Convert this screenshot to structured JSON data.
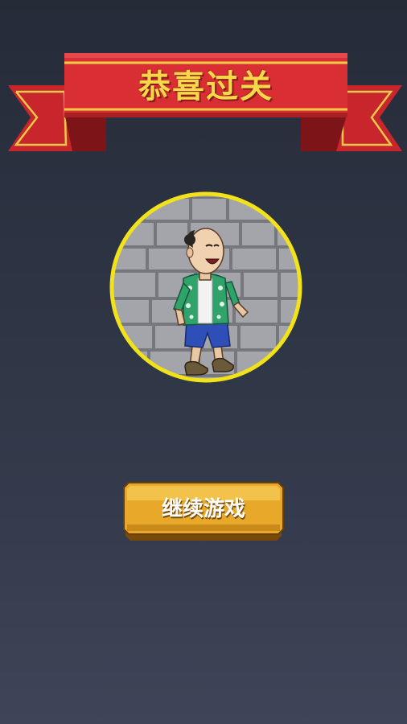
{
  "banner": {
    "title": "恭喜过关",
    "ribbon_color": "#d92e33",
    "text_color": "#f7d84a"
  },
  "portrait": {
    "ring_color": "#f2e21a",
    "background": "stone-wall",
    "character": "bald-man-in-hawaiian-shirt"
  },
  "continue_button": {
    "label": "继续游戏",
    "color": "#e8a92a"
  }
}
